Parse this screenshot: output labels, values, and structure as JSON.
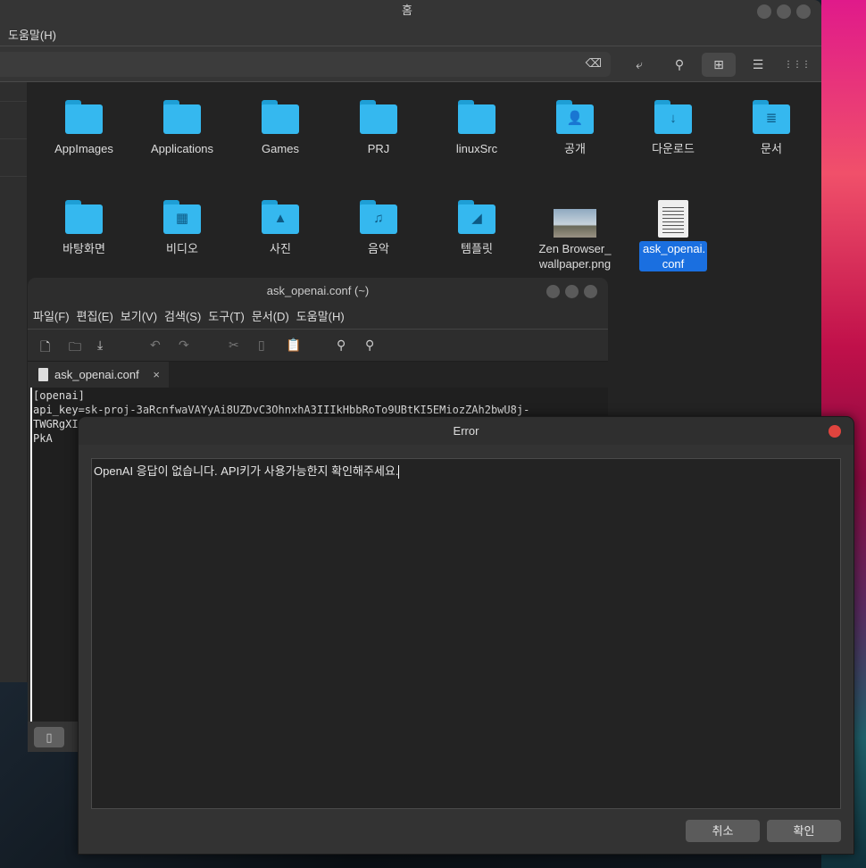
{
  "file_manager": {
    "title": "홈",
    "menu_help": "도움말(H)",
    "toolbar": {
      "clear": "⌫",
      "wrap": "⤶",
      "search": "⚲",
      "icon_view": "⊞",
      "list_view": "☰",
      "compact_view": "⋮⋮⋮"
    },
    "items": [
      {
        "label": "AppImages",
        "type": "folder",
        "glyph": ""
      },
      {
        "label": "Applications",
        "type": "folder",
        "glyph": ""
      },
      {
        "label": "Games",
        "type": "folder",
        "glyph": ""
      },
      {
        "label": "PRJ",
        "type": "folder",
        "glyph": ""
      },
      {
        "label": "linuxSrc",
        "type": "folder",
        "glyph": ""
      },
      {
        "label": "공개",
        "type": "folder",
        "glyph": "👤"
      },
      {
        "label": "다운로드",
        "type": "folder",
        "glyph": "↓"
      },
      {
        "label": "문서",
        "type": "folder",
        "glyph": "≣"
      },
      {
        "label": "바탕화면",
        "type": "folder",
        "glyph": ""
      },
      {
        "label": "비디오",
        "type": "folder",
        "glyph": "▦"
      },
      {
        "label": "사진",
        "type": "folder",
        "glyph": "▲"
      },
      {
        "label": "음악",
        "type": "folder",
        "glyph": "♫"
      },
      {
        "label": "템플릿",
        "type": "folder",
        "glyph": "◢"
      },
      {
        "label": "Zen Browser_ wallpaper.png",
        "type": "image",
        "glyph": ""
      },
      {
        "label": "ask_openai. conf",
        "type": "text-file",
        "glyph": "",
        "selected": true
      }
    ]
  },
  "editor": {
    "title": "ask_openai.conf (~)",
    "menu": [
      "파일(F)",
      "편집(E)",
      "보기(V)",
      "검색(S)",
      "도구(T)",
      "문서(D)",
      "도움말(H)"
    ],
    "tab_label": "ask_openai.conf",
    "tab_close": "×",
    "content": "[openai]\napi_key=sk-proj-3aRcnfwaVAYyAi8UZDvC3OhnxhA3IIIkHbbRoTo9UBtKI5EMiozZAh2bwU8j-\nTWGRgXI\nPkA"
  },
  "dialog": {
    "title": "Error",
    "message": "OpenAI 응답이 없습니다. API키가 사용가능한지 확인해주세요.",
    "cancel": "취소",
    "ok": "확인",
    "close_color": "#e0443e"
  },
  "colors": {
    "folder": "#35b8ef",
    "selection": "#1a6fe0"
  }
}
